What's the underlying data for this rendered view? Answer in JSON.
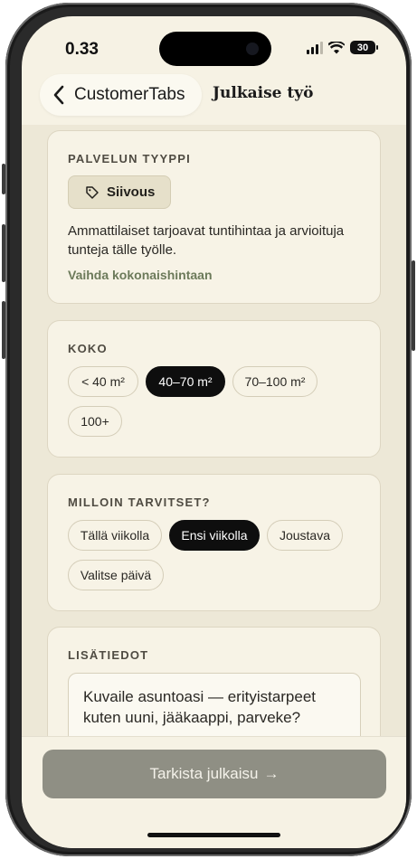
{
  "status": {
    "time": "0.33",
    "battery": "30"
  },
  "header": {
    "back_label": "CustomerTabs",
    "title": "Julkaise työ"
  },
  "service": {
    "label": "PALVELUN TYYPPI",
    "tag": "Siivous",
    "description": "Ammattilaiset tarjoavat tuntihintaa ja arvioituja tunteja tälle työlle.",
    "switch_link": "Vaihda kokonaishintaan"
  },
  "size": {
    "label": "KOKO",
    "options": [
      "< 40 m²",
      "40–70 m²",
      "70–100 m²",
      "100+"
    ],
    "selected": "40–70 m²"
  },
  "when": {
    "label": "MILLOIN TARVITSET?",
    "options": [
      "Tällä viikolla",
      "Ensi viikolla",
      "Joustava",
      "Valitse päivä"
    ],
    "selected": "Ensi viikolla"
  },
  "details": {
    "label": "LISÄTIEDOT",
    "placeholder": "Kuvaile asuntoasi — erityistarpeet kuten uuni, jääkaappi, parveke?"
  },
  "cta": {
    "label": "Tarkista julkaisu",
    "arrow": "→"
  }
}
